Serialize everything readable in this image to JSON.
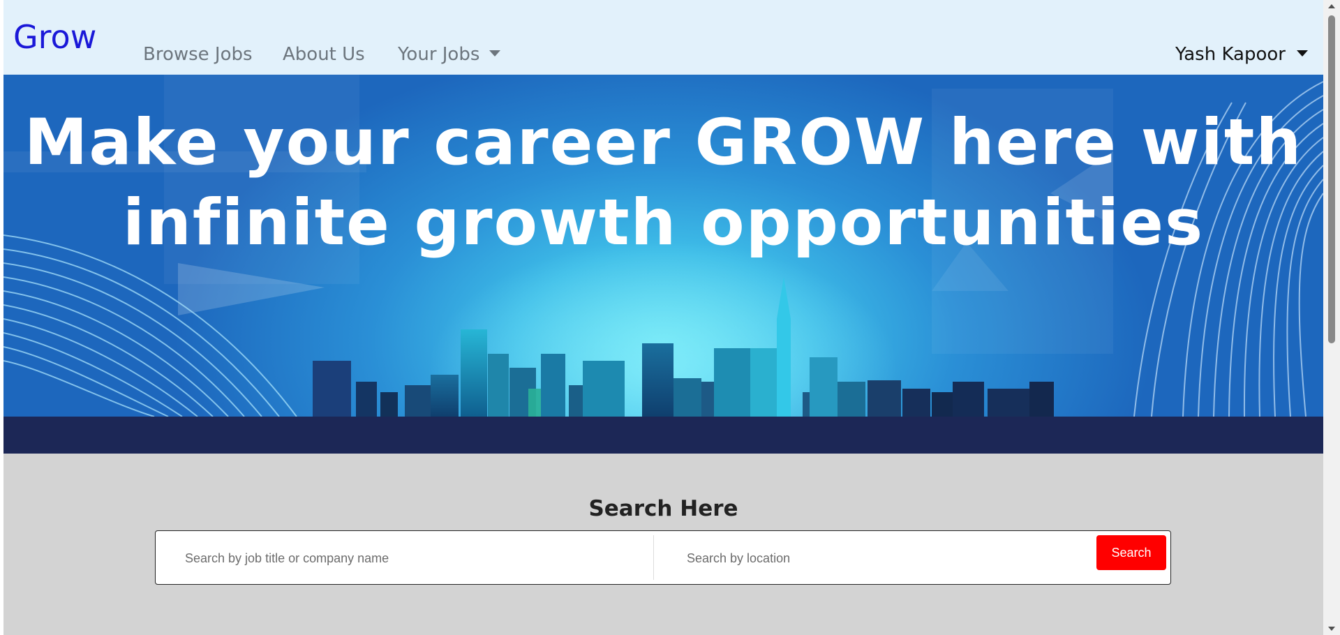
{
  "navbar": {
    "brand": "Grow",
    "links": [
      {
        "label": "Browse Jobs"
      },
      {
        "label": "About Us"
      },
      {
        "label": "Your Jobs"
      }
    ],
    "user_name": "Yash Kapoor"
  },
  "hero": {
    "title_line1": "Make your career GROW here with",
    "title_line2": "infinite growth opportunities"
  },
  "search": {
    "heading": "Search Here",
    "job_placeholder": "Search by job title or company name",
    "location_placeholder": "Search by location",
    "button_label": "Search"
  },
  "colors": {
    "brand": "#1a18d8",
    "navbar_bg": "#e2f1fb",
    "search_button": "#ff0000",
    "page_bg": "#d3d3d3",
    "hero_ground": "#1c2756"
  }
}
